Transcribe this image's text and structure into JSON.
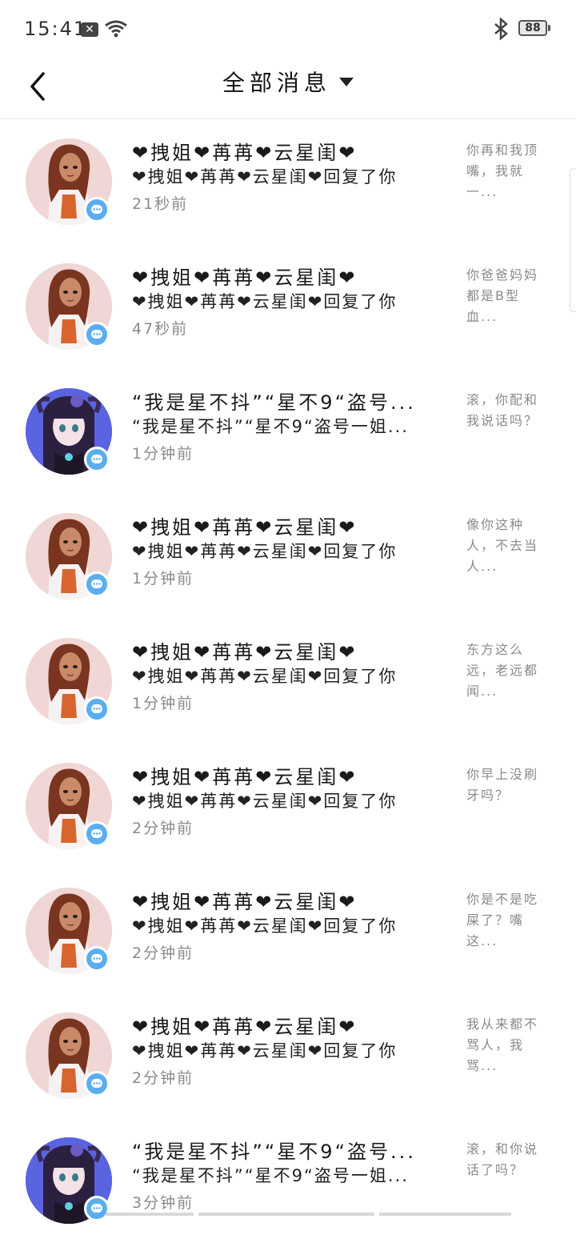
{
  "status_bar": {
    "time": "15:41",
    "battery": "88"
  },
  "header": {
    "title": "全部消息"
  },
  "items": [
    {
      "avatar": "girl",
      "name": "❤拽姐❤苒苒❤云星闺❤",
      "action": "❤拽姐❤苒苒❤云星闺❤回复了你",
      "time": "21秒前",
      "preview": "你再和我顶嘴，我就一..."
    },
    {
      "avatar": "girl",
      "name": "❤拽姐❤苒苒❤云星闺❤",
      "action": "❤拽姐❤苒苒❤云星闺❤回复了你",
      "time": "47秒前",
      "preview": "你爸爸妈妈都是B型血..."
    },
    {
      "avatar": "anime",
      "name": "“我是星不抖”“星不9“盗号...",
      "action": "“我是星不抖”“星不9“盗号一姐...",
      "time": "1分钟前",
      "preview": "滚，你配和我说话吗？"
    },
    {
      "avatar": "girl",
      "name": "❤拽姐❤苒苒❤云星闺❤",
      "action": "❤拽姐❤苒苒❤云星闺❤回复了你",
      "time": "1分钟前",
      "preview": "像你这种人，不去当人..."
    },
    {
      "avatar": "girl",
      "name": "❤拽姐❤苒苒❤云星闺❤",
      "action": "❤拽姐❤苒苒❤云星闺❤回复了你",
      "time": "1分钟前",
      "preview": "东方这么远，老远都闻..."
    },
    {
      "avatar": "girl",
      "name": "❤拽姐❤苒苒❤云星闺❤",
      "action": "❤拽姐❤苒苒❤云星闺❤回复了你",
      "time": "2分钟前",
      "preview": "你早上没刷牙吗？"
    },
    {
      "avatar": "girl",
      "name": "❤拽姐❤苒苒❤云星闺❤",
      "action": "❤拽姐❤苒苒❤云星闺❤回复了你",
      "time": "2分钟前",
      "preview": "你是不是吃屎了？嘴这..."
    },
    {
      "avatar": "girl",
      "name": "❤拽姐❤苒苒❤云星闺❤",
      "action": "❤拽姐❤苒苒❤云星闺❤回复了你",
      "time": "2分钟前",
      "preview": "我从来都不骂人，我骂..."
    },
    {
      "avatar": "anime",
      "name": "“我是星不抖”“星不9“盗号...",
      "action": "“我是星不抖”“星不9“盗号一姐...",
      "time": "3分钟前",
      "preview": "滚，和你说话了吗？"
    }
  ]
}
